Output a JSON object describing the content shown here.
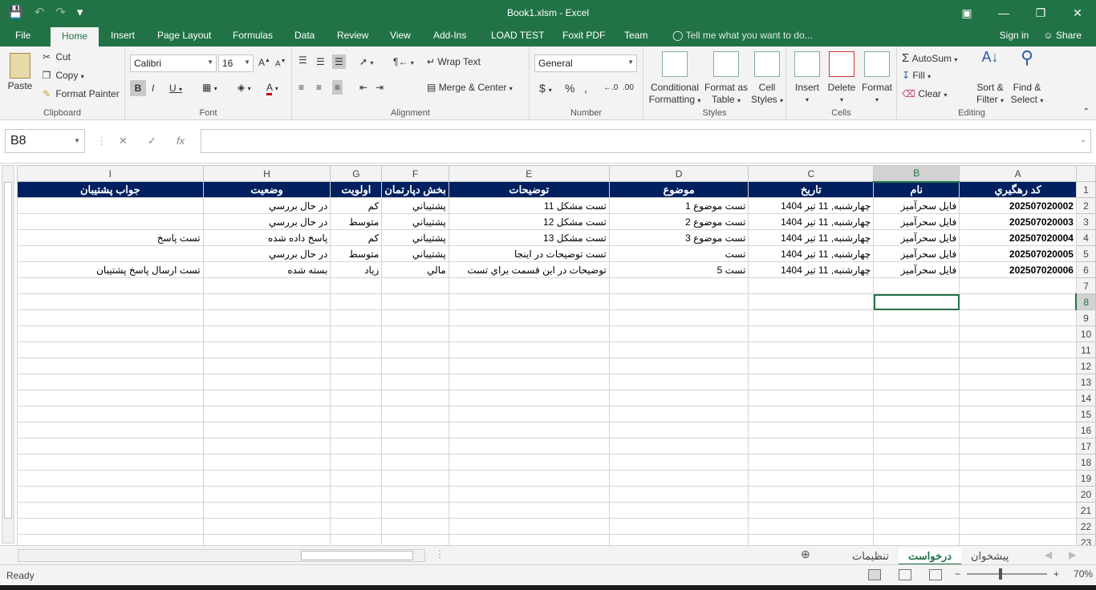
{
  "window": {
    "title": "Book1.xlsm - Excel",
    "customize_qat": "▾"
  },
  "ribbon_tabs": [
    "File",
    "Home",
    "Insert",
    "Page Layout",
    "Formulas",
    "Data",
    "Review",
    "View",
    "Add-Ins",
    "LOAD TEST",
    "Foxit PDF",
    "Team"
  ],
  "tell_me": "Tell me what you want to do...",
  "sign_in": "Sign in",
  "share": "Share",
  "clipboard": {
    "paste": "Paste",
    "cut": "Cut",
    "copy": "Copy",
    "format_painter": "Format Painter",
    "label": "Clipboard"
  },
  "font": {
    "name": "Calibri",
    "size": "16",
    "label": "Font"
  },
  "alignment": {
    "wrap_text": "Wrap Text",
    "merge_center": "Merge & Center",
    "label": "Alignment"
  },
  "number": {
    "format": "General",
    "label": "Number"
  },
  "styles": {
    "conditional": "Conditional",
    "formatting": "Formatting",
    "format_as": "Format as",
    "table": "Table",
    "cell": "Cell",
    "cell_styles": "Styles",
    "label": "Styles"
  },
  "cells": {
    "insert": "Insert",
    "delete": "Delete",
    "format": "Format",
    "label": "Cells"
  },
  "editing": {
    "autosum": "AutoSum",
    "fill": "Fill",
    "clear": "Clear",
    "sort": "Sort &",
    "filter": "Filter",
    "find": "Find &",
    "select": "Select",
    "label": "Editing"
  },
  "formula_bar": {
    "name_box": "B8",
    "fx": "fx",
    "value": ""
  },
  "columns": [
    "A",
    "B",
    "C",
    "D",
    "E",
    "F",
    "G",
    "H",
    "I"
  ],
  "selected_column": "B",
  "selected_row": 8,
  "header_row": [
    "کد رهگيري",
    "نام",
    "تاريخ",
    "موضوع",
    "توضيحات",
    "بخش دپارتمان",
    "اولويت",
    "وضعيت",
    "جواب پشتيبان"
  ],
  "data_rows": [
    [
      "202507020002",
      "فایل سحرآمیز",
      "چهارشنبه, 11 تير 1404",
      "تست موضوع 1",
      "تست مشکل 11",
      "پشتيباني",
      "کم",
      "در حال بررسي",
      ""
    ],
    [
      "202507020003",
      "فایل سحرآمیز",
      "چهارشنبه, 11 تير 1404",
      "تست موضوع 2",
      "تست مشکل 12",
      "پشتيباني",
      "متوسط",
      "در حال بررسي",
      ""
    ],
    [
      "202507020004",
      "فایل سحرآمیز",
      "چهارشنبه, 11 تير 1404",
      "تست موضوع 3",
      "تست مشکل 13",
      "پشتيباني",
      "کم",
      "پاسخ داده شده",
      "تست پاسخ"
    ],
    [
      "202507020005",
      "فایل سحرآمیز",
      "چهارشنبه, 11 تير 1404",
      "تست",
      "تست توضيحات در اينجا",
      "پشتيباني",
      "متوسط",
      "در حال بررسي",
      ""
    ],
    [
      "202507020006",
      "فایل سحرآمیز",
      "چهارشنبه, 11 تير 1404",
      "تست 5",
      "توضيحات در اين قسمت براي تست",
      "مالي",
      "زياد",
      "بسته شده",
      "تست ارسال پاسخ پشتيبان"
    ]
  ],
  "row_numbers": [
    1,
    2,
    3,
    4,
    5,
    6,
    7,
    8,
    9,
    10,
    11,
    12,
    13,
    14,
    15,
    16,
    17,
    18,
    19,
    20,
    21,
    22,
    23
  ],
  "sheet_tabs": [
    "تنظيمات",
    "درخواست",
    "پيشخوان"
  ],
  "active_sheet": "درخواست",
  "status": {
    "ready": "Ready",
    "zoom": "70%"
  }
}
